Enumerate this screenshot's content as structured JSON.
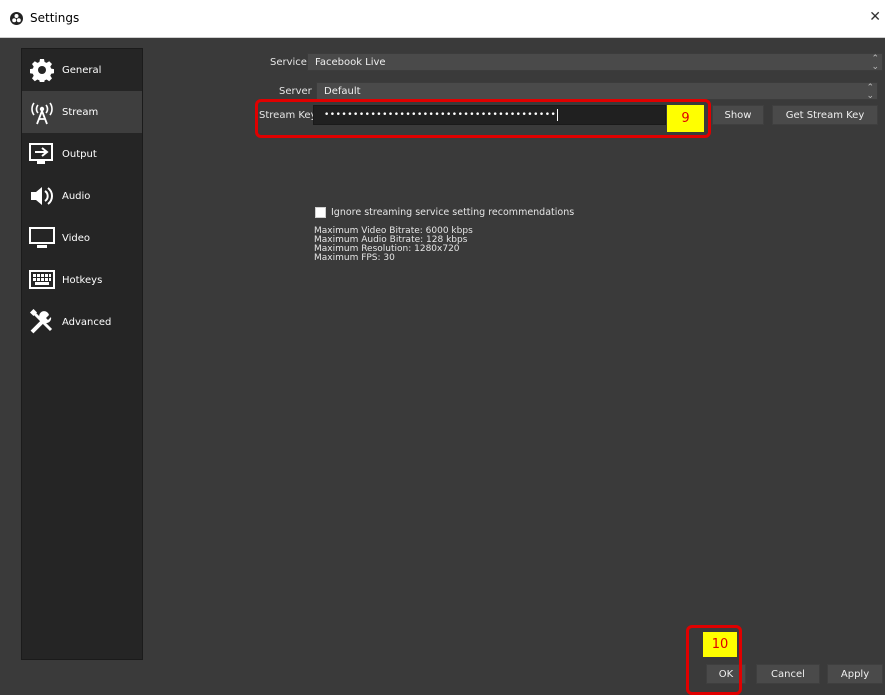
{
  "window": {
    "title": "Settings",
    "close_glyph": "✕"
  },
  "sidebar": {
    "items": [
      {
        "label": "General",
        "icon": "gear-icon"
      },
      {
        "label": "Stream",
        "icon": "antenna-icon"
      },
      {
        "label": "Output",
        "icon": "output-icon"
      },
      {
        "label": "Audio",
        "icon": "speaker-icon"
      },
      {
        "label": "Video",
        "icon": "monitor-icon"
      },
      {
        "label": "Hotkeys",
        "icon": "keyboard-icon"
      },
      {
        "label": "Advanced",
        "icon": "tools-icon"
      }
    ],
    "active": "Stream"
  },
  "stream": {
    "service_label": "Service",
    "service_value": "Facebook Live",
    "server_label": "Server",
    "server_value": "Default",
    "key_label": "Stream Key",
    "key_value": "••••••••••••••••••••••••••••••••••••••••",
    "show_button": "Show",
    "get_key_button": "Get Stream Key",
    "ignore_checkbox_label": "Ignore streaming service setting recommendations",
    "recommendations": [
      "Maximum Video Bitrate: 6000 kbps",
      "Maximum Audio Bitrate: 128 kbps",
      "Maximum Resolution: 1280x720",
      "Maximum FPS: 30"
    ]
  },
  "annotations": {
    "step_9": "9",
    "step_10": "10",
    "highlight_color": "#e00000",
    "badge_color": "#ffff00"
  },
  "footer": {
    "ok_button": "OK",
    "cancel_button": "Cancel",
    "apply_button": "Apply"
  }
}
